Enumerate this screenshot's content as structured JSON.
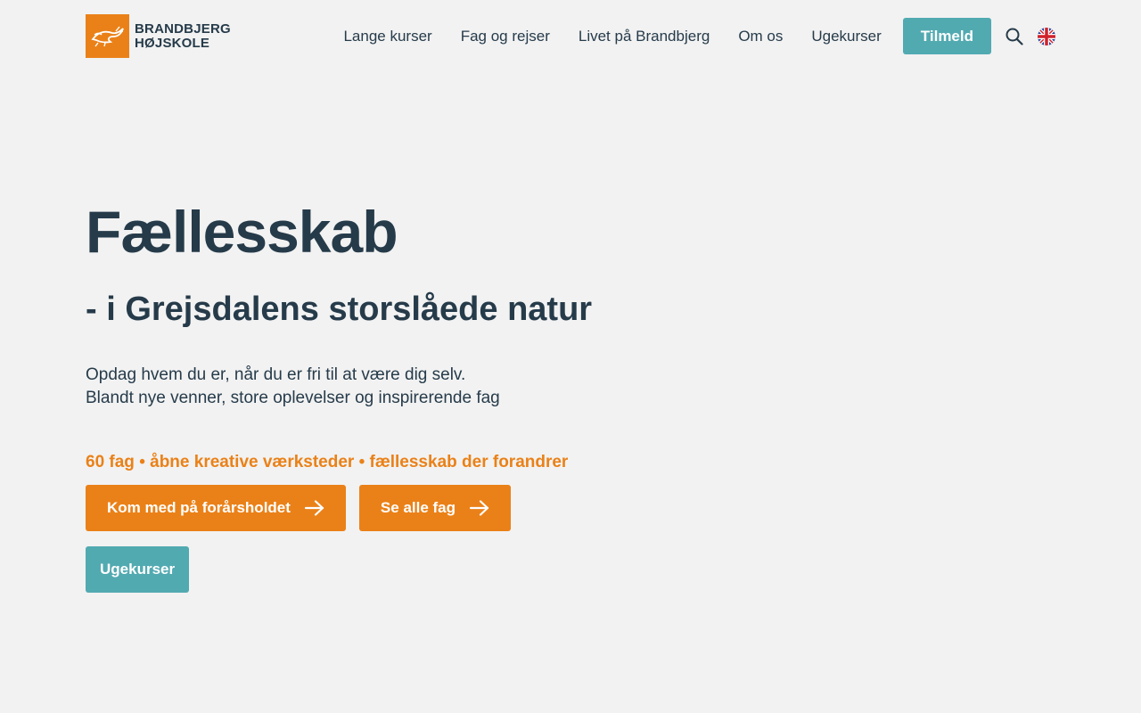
{
  "header": {
    "logo_line1": "BRANDBJERG",
    "logo_line2": "HØJSKOLE",
    "nav": [
      {
        "label": "Lange kurser"
      },
      {
        "label": "Fag og rejser"
      },
      {
        "label": "Livet på Brandbjerg"
      },
      {
        "label": "Om os"
      },
      {
        "label": "Ugekurser"
      }
    ],
    "cta_label": "Tilmeld",
    "search_icon": "search-icon",
    "language_icon": "uk-flag-icon"
  },
  "hero": {
    "title": "Fællesskab",
    "subtitle": "- i Grejsdalens storslåede natur",
    "text_line1": "Opdag hvem du er, når du er fri til at være dig selv.",
    "text_line2": "Blandt nye venner, store oplevelser og inspirerende fag",
    "tagline": "60 fag • åbne kreative værksteder • fællesskab der forandrer",
    "primary_button": "Kom med på forårsholdet",
    "secondary_button": "Se alle fag",
    "tertiary_button": "Ugekurser"
  },
  "colors": {
    "background": "#f2f2f2",
    "text": "#263b4a",
    "orange": "#ea8118",
    "teal": "#52aab1"
  }
}
